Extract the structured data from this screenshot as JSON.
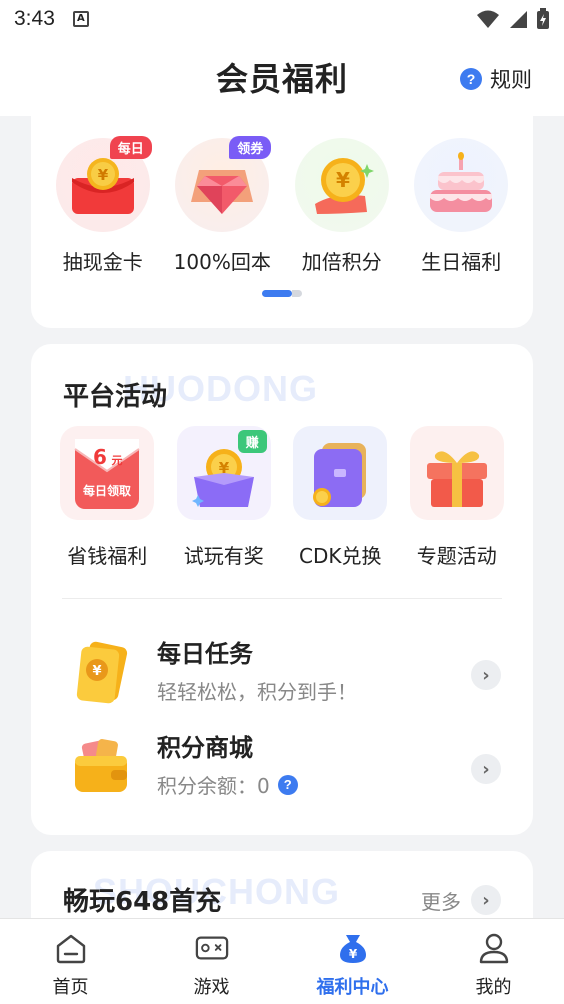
{
  "status_bar": {
    "time": "3:43",
    "notification_icon": "A"
  },
  "header": {
    "title": "会员福利",
    "rules_label": "规则",
    "rules_icon": "?"
  },
  "vip_benefits": {
    "items": [
      {
        "label": "抽现金卡",
        "tag": "每日",
        "tag_color": "#f0434f",
        "icon": "red-envelope-icon"
      },
      {
        "label": "100%回本",
        "tag": "领券",
        "tag_color": "#7a5cf6",
        "icon": "diamond-icon"
      },
      {
        "label": "加倍积分",
        "tag": "",
        "icon": "gold-coin-icon"
      },
      {
        "label": "生日福利",
        "tag": "",
        "icon": "birthday-cake-icon"
      }
    ]
  },
  "platform": {
    "title": "平台活动",
    "watermark": "HUODONG",
    "activities": [
      {
        "label": "省钱福利",
        "icon": "coupon-envelope-icon",
        "icon_text_big": "6",
        "icon_text_unit": "元",
        "icon_text_sub": "每日领取"
      },
      {
        "label": "试玩有奖",
        "icon": "coin-box-icon",
        "badge": "赚"
      },
      {
        "label": "CDK兑换",
        "icon": "purple-wallet-icon"
      },
      {
        "label": "专题活动",
        "icon": "gift-box-icon"
      }
    ],
    "tasks": [
      {
        "name": "每日任务",
        "desc": "轻轻松松，积分到手！"
      },
      {
        "name": "积分商城",
        "desc": "积分余额：0",
        "help_icon": "?"
      }
    ]
  },
  "first_charge": {
    "title": "畅玩648首充",
    "watermark": "SHOUCHONG",
    "more_label": "更多"
  },
  "bottom_nav": {
    "items": [
      {
        "label": "首页",
        "active": false
      },
      {
        "label": "游戏",
        "active": false
      },
      {
        "label": "福利中心",
        "active": true
      },
      {
        "label": "我的",
        "active": false
      }
    ]
  },
  "colors": {
    "accent": "#2f6fed",
    "help_blue": "#3d7bf0"
  }
}
